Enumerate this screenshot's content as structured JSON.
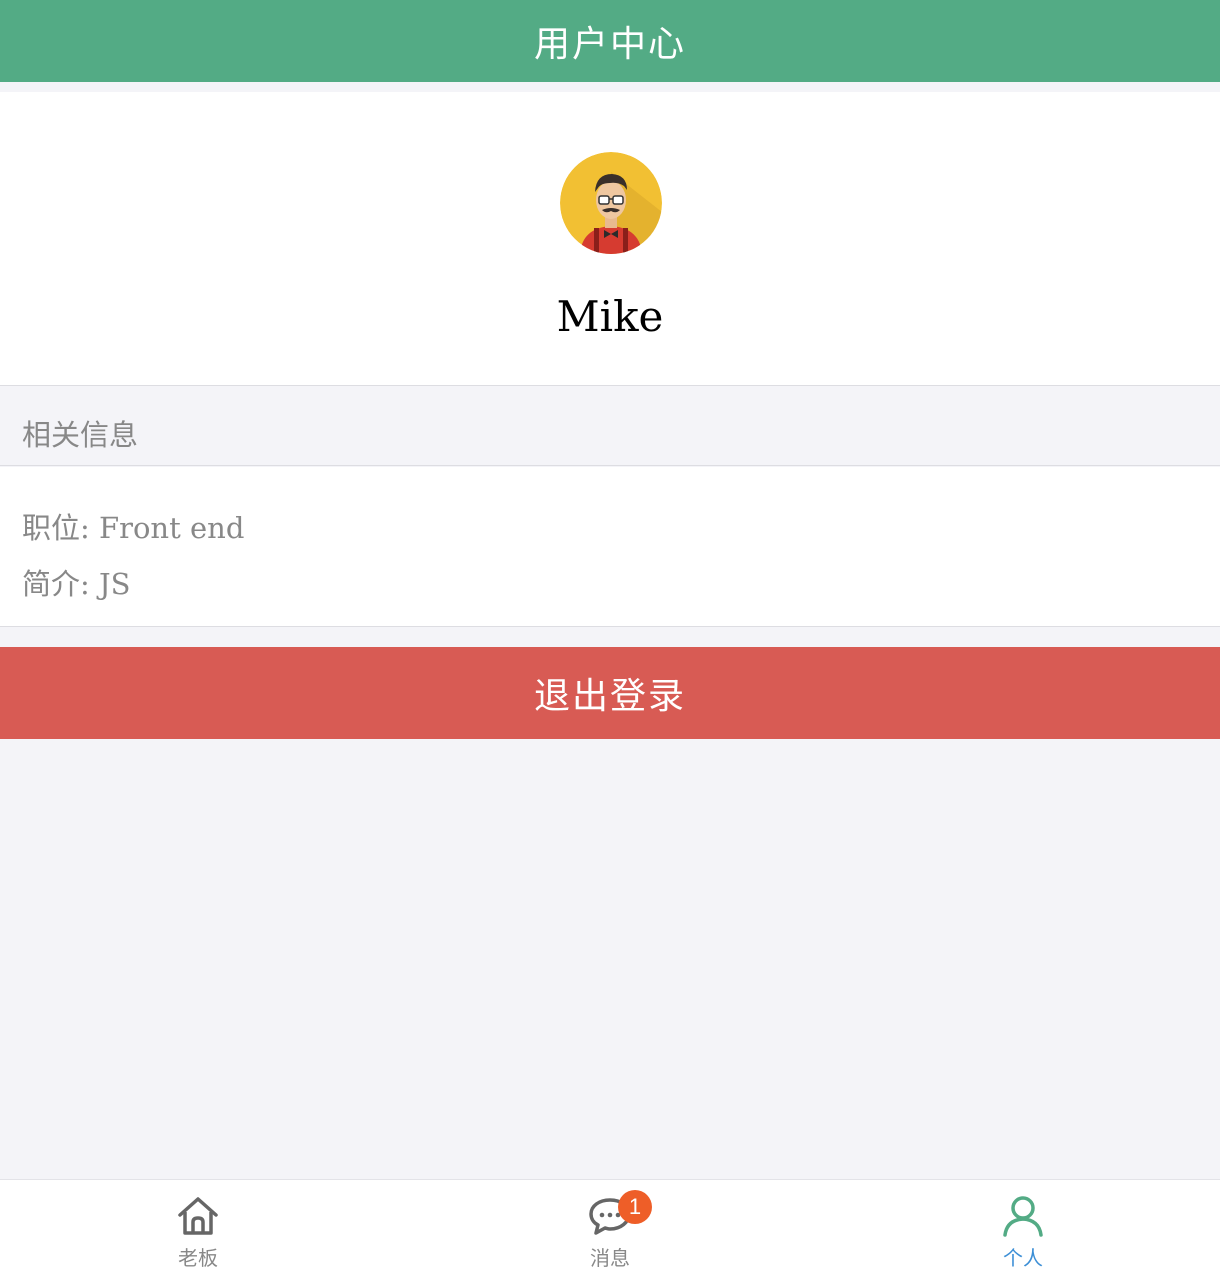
{
  "header": {
    "title": "用户中心"
  },
  "profile": {
    "username": "Mike"
  },
  "info": {
    "section_title": "相关信息",
    "position_line": "职位: Front end",
    "intro_line": "简介: JS"
  },
  "logout": {
    "label": "退出登录"
  },
  "tabbar": {
    "tabs": [
      {
        "label": "老板",
        "icon": "home-icon"
      },
      {
        "label": "消息",
        "icon": "chat-icon",
        "badge": "1"
      },
      {
        "label": "个人",
        "icon": "user-icon",
        "active": true
      }
    ]
  },
  "colors": {
    "header_bg": "#53ab85",
    "logout_bg": "#d85b54",
    "active_tab_label": "#3d8fd6",
    "active_tab_icon": "#53ab85",
    "badge_bg": "#ee5e28"
  }
}
